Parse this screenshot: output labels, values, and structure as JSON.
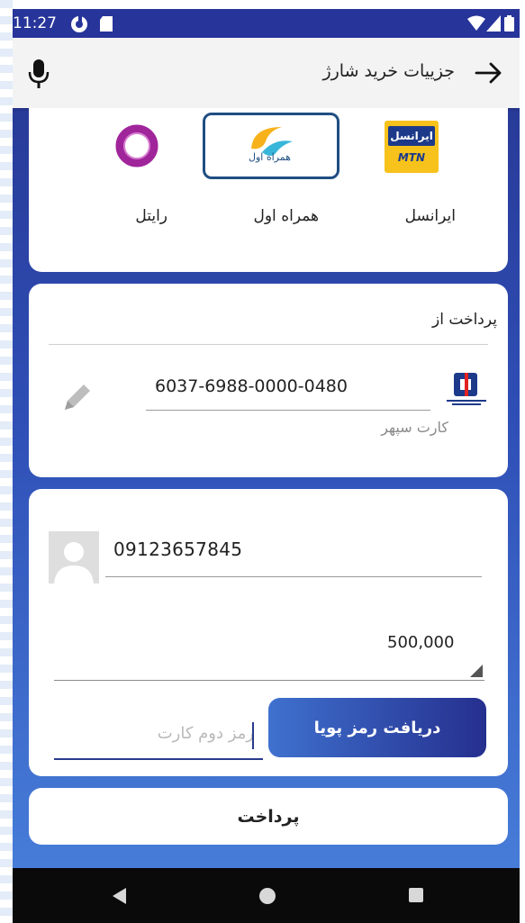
{
  "status_bar": {
    "time": "11:27"
  },
  "app_bar": {
    "title": "جزییات خرید شارژ"
  },
  "operators": {
    "irancell": {
      "label": "ایرانسل",
      "logo_text": "ایرانسل",
      "logo_sub": "MTN"
    },
    "hamrah_aval": {
      "label": "همراه اول",
      "logo_text": "همراه اول",
      "selected": true
    },
    "rightel": {
      "label": "رایتل"
    }
  },
  "payment_source": {
    "title": "پرداخت از",
    "card_number": "6037-6988-0000-0480",
    "card_name": "کارت سپهر",
    "bank_icon": "bank-saderat-logo"
  },
  "recipient": {
    "phone_number": "09123657845",
    "amount": "500,000"
  },
  "otp_button": {
    "label": "دریافت رمز پویا"
  },
  "second_pin": {
    "placeholder": "رمز دوم کارت"
  },
  "pay_button": {
    "label": "پرداخت"
  },
  "colors": {
    "primary_dark": "#252f8e",
    "primary_light": "#3f71cf",
    "selected_border": "#1f4e82",
    "rightel_purple": "#a0259b",
    "irancell_yellow": "#f7c21b"
  }
}
